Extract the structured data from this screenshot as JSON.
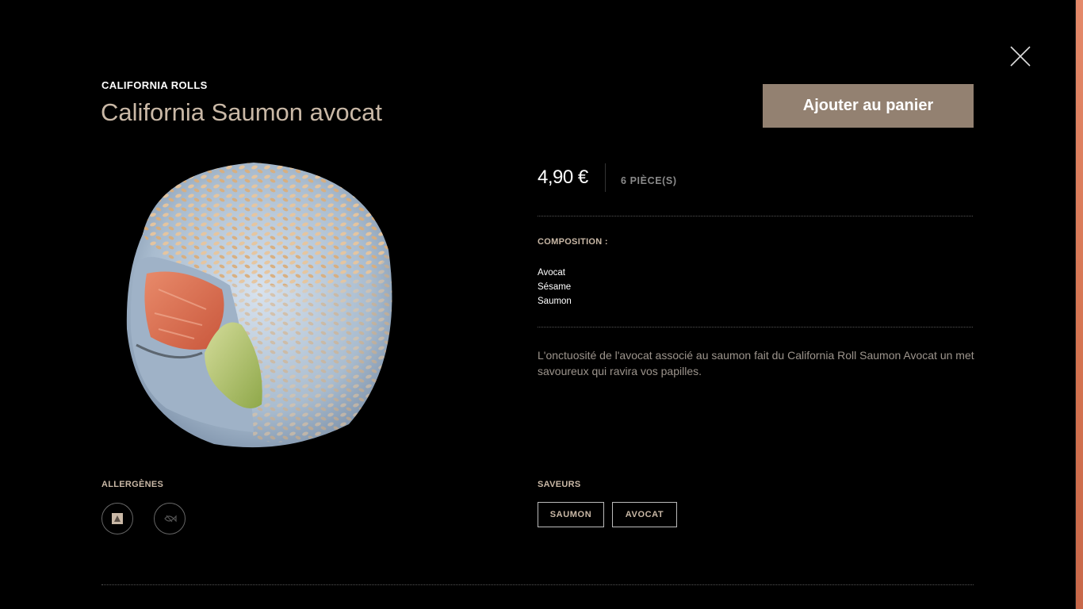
{
  "product": {
    "category": "CALIFORNIA ROLLS",
    "title": "California Saumon avocat",
    "add_to_cart_label": "Ajouter au panier",
    "price": "4,90 €",
    "pieces": "6 PIÈCE(S)",
    "image_icon": "california-roll-salmon-avocado-photo"
  },
  "composition": {
    "label": "COMPOSITION :",
    "items": [
      "Avocat",
      "Sésame",
      "Saumon"
    ]
  },
  "description": "L'onctuosité de l'avocat associé au saumon fait du California Roll Saumon Avocat un met savoureux qui ravira vos papilles.",
  "allergens": {
    "label": "ALLERGÈNES",
    "icons": [
      "allergen-sesame-icon",
      "allergen-fish-icon"
    ]
  },
  "flavors": {
    "label": "SAVEURS",
    "tags": [
      "SAUMON",
      "AVOCAT"
    ]
  },
  "colors": {
    "background": "#000000",
    "accent_button": "#938171",
    "title_beige": "#c9b8a6",
    "side_strip": "#e4896a"
  },
  "icons": {
    "close": "close-icon"
  }
}
